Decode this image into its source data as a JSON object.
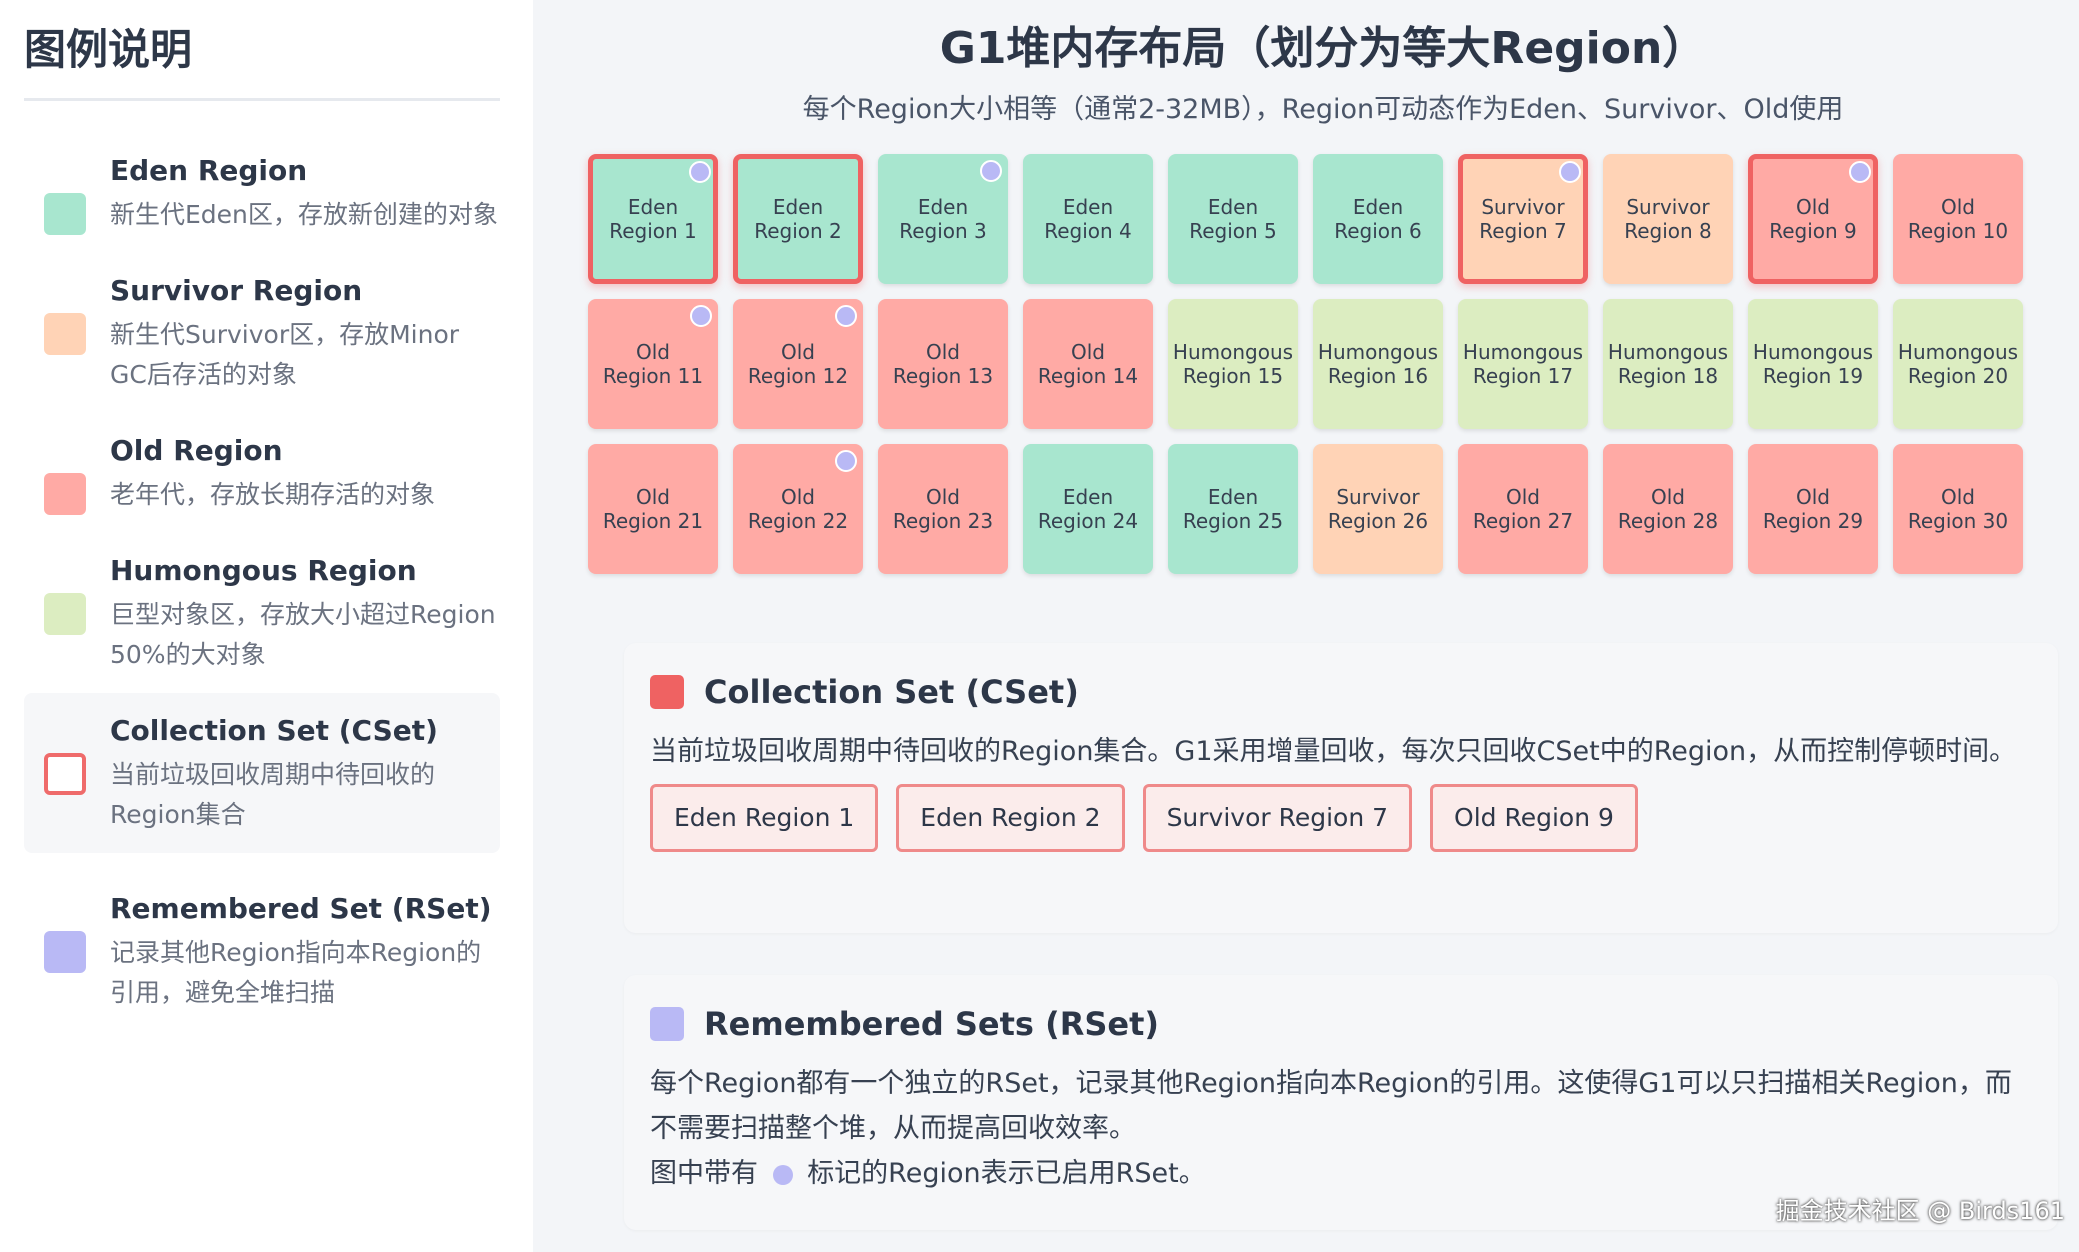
{
  "colors": {
    "eden": "#a8e6cf",
    "survivor": "#ffd3b6",
    "old": "#ffaaa5",
    "humongous": "#dcedc1",
    "cset_border": "#ef6262",
    "rset": "#b9b9f5"
  },
  "legend": {
    "title": "图例说明",
    "items": [
      {
        "name": "Eden Region",
        "desc": "新生代Eden区，存放新创建的对象",
        "kind": "eden"
      },
      {
        "name": "Survivor Region",
        "desc": "新生代Survivor区，存放Minor GC后存活的对象",
        "kind": "survivor"
      },
      {
        "name": "Old Region",
        "desc": "老年代，存放长期存活的对象",
        "kind": "old"
      },
      {
        "name": "Humongous Region",
        "desc": "巨型对象区，存放大小超过Region 50%的大对象",
        "kind": "humongous"
      },
      {
        "name": "Collection Set (CSet)",
        "desc": "当前垃圾回收周期中待回收的Region集合",
        "kind": "cset"
      },
      {
        "name": "Remembered Set (RSet)",
        "desc": "记录其他Region指向本Region的引用，避免全堆扫描",
        "kind": "rset"
      }
    ]
  },
  "main": {
    "title": "G1堆内存布局（划分为等大Region）",
    "subtitle": "每个Region大小相等（通常2-32MB），Region可动态作为Eden、Survivor、Old使用"
  },
  "regions": [
    {
      "label": "Eden\nRegion 1",
      "kind": "eden",
      "cset": true,
      "rset": true
    },
    {
      "label": "Eden\nRegion 2",
      "kind": "eden",
      "cset": true,
      "rset": false
    },
    {
      "label": "Eden\nRegion 3",
      "kind": "eden",
      "cset": false,
      "rset": true
    },
    {
      "label": "Eden\nRegion 4",
      "kind": "eden",
      "cset": false,
      "rset": false
    },
    {
      "label": "Eden\nRegion 5",
      "kind": "eden",
      "cset": false,
      "rset": false
    },
    {
      "label": "Eden\nRegion 6",
      "kind": "eden",
      "cset": false,
      "rset": false
    },
    {
      "label": "Survivor\nRegion 7",
      "kind": "survivor",
      "cset": true,
      "rset": true
    },
    {
      "label": "Survivor\nRegion 8",
      "kind": "survivor",
      "cset": false,
      "rset": false
    },
    {
      "label": "Old\nRegion 9",
      "kind": "old",
      "cset": true,
      "rset": true
    },
    {
      "label": "Old\nRegion 10",
      "kind": "old",
      "cset": false,
      "rset": false
    },
    {
      "label": "Old\nRegion 11",
      "kind": "old",
      "cset": false,
      "rset": true
    },
    {
      "label": "Old\nRegion 12",
      "kind": "old",
      "cset": false,
      "rset": true
    },
    {
      "label": "Old\nRegion 13",
      "kind": "old",
      "cset": false,
      "rset": false
    },
    {
      "label": "Old\nRegion 14",
      "kind": "old",
      "cset": false,
      "rset": false
    },
    {
      "label": "Humongous\nRegion 15",
      "kind": "humongous",
      "cset": false,
      "rset": false
    },
    {
      "label": "Humongous\nRegion 16",
      "kind": "humongous",
      "cset": false,
      "rset": false
    },
    {
      "label": "Humongous\nRegion 17",
      "kind": "humongous",
      "cset": false,
      "rset": false
    },
    {
      "label": "Humongous\nRegion 18",
      "kind": "humongous",
      "cset": false,
      "rset": false
    },
    {
      "label": "Humongous\nRegion 19",
      "kind": "humongous",
      "cset": false,
      "rset": false
    },
    {
      "label": "Humongous\nRegion 20",
      "kind": "humongous",
      "cset": false,
      "rset": false
    },
    {
      "label": "Old\nRegion 21",
      "kind": "old",
      "cset": false,
      "rset": false
    },
    {
      "label": "Old\nRegion 22",
      "kind": "old",
      "cset": false,
      "rset": true
    },
    {
      "label": "Old\nRegion 23",
      "kind": "old",
      "cset": false,
      "rset": false
    },
    {
      "label": "Eden\nRegion 24",
      "kind": "eden",
      "cset": false,
      "rset": false
    },
    {
      "label": "Eden\nRegion 25",
      "kind": "eden",
      "cset": false,
      "rset": false
    },
    {
      "label": "Survivor\nRegion 26",
      "kind": "survivor",
      "cset": false,
      "rset": false
    },
    {
      "label": "Old\nRegion 27",
      "kind": "old",
      "cset": false,
      "rset": false
    },
    {
      "label": "Old\nRegion 28",
      "kind": "old",
      "cset": false,
      "rset": false
    },
    {
      "label": "Old\nRegion 29",
      "kind": "old",
      "cset": false,
      "rset": false
    },
    {
      "label": "Old\nRegion 30",
      "kind": "old",
      "cset": false,
      "rset": false
    }
  ],
  "cset_card": {
    "title": "Collection Set (CSet)",
    "body": "当前垃圾回收周期中待回收的Region集合。G1采用增量回收，每次只回收CSet中的Region，从而控制停顿时间。",
    "chips": [
      "Eden Region 1",
      "Eden Region 2",
      "Survivor Region 7",
      "Old Region 9"
    ]
  },
  "rset_card": {
    "title": "Remembered Sets (RSet)",
    "body": "每个Region都有一个独立的RSet，记录其他Region指向本Region的引用。这使得G1可以只扫描相关Region，而不需要扫描整个堆，从而提高回收效率。",
    "note_prefix": "图中带有",
    "note_suffix": "标记的Region表示已启用RSet。"
  },
  "watermark": "掘金技术社区 @ Birds161"
}
